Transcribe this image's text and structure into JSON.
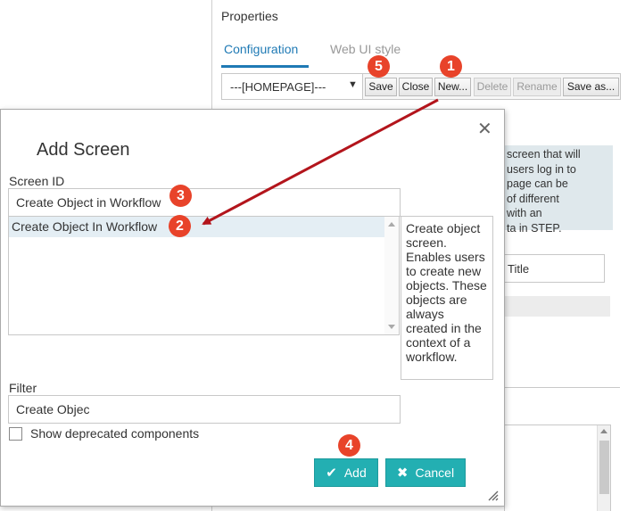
{
  "properties_window": {
    "title": "Properties",
    "tabs": [
      {
        "label": "Configuration",
        "active": true
      },
      {
        "label": "Web UI style",
        "active": false
      }
    ],
    "homepage_select": {
      "value": "---[HOMEPAGE]---",
      "caret": "▼"
    },
    "toolbar_buttons": [
      {
        "label": "Save",
        "enabled": true
      },
      {
        "label": "Close",
        "enabled": true
      },
      {
        "label": "New...",
        "enabled": true
      },
      {
        "label": "Delete",
        "enabled": false
      },
      {
        "label": "Rename",
        "enabled": false
      },
      {
        "label": "Save as...",
        "enabled": true
      }
    ],
    "help_lines": [
      "screen that will",
      "users log in to",
      "page can be",
      "of different",
      "with an",
      "ta in STEP."
    ],
    "title_field_value": "Title"
  },
  "dialog": {
    "title": "Add Screen",
    "close_glyph": "✕",
    "screen_id_label": "Screen ID",
    "screen_id_value": "Create Object in Workflow",
    "list_items": [
      {
        "label": "Create Object In Workflow",
        "selected": true
      }
    ],
    "description": "Create object screen. Enables users to create new objects. These objects are always created in the context of a workflow.",
    "filter_label": "Filter",
    "filter_value": "Create Objec",
    "show_deprecated_label": "Show deprecated components",
    "show_deprecated_checked": false,
    "add_label": "Add",
    "cancel_label": "Cancel"
  },
  "callouts": [
    "1",
    "2",
    "3",
    "4",
    "5"
  ],
  "colors": {
    "accent_tab": "#1f7ab5",
    "button_teal": "#23afb2",
    "callout_red": "#e8432a",
    "arrow_red": "#b3151c"
  },
  "icons": {
    "add_icon": "checkmark-icon",
    "cancel_icon": "x-icon",
    "dialog_close": "close-icon"
  }
}
